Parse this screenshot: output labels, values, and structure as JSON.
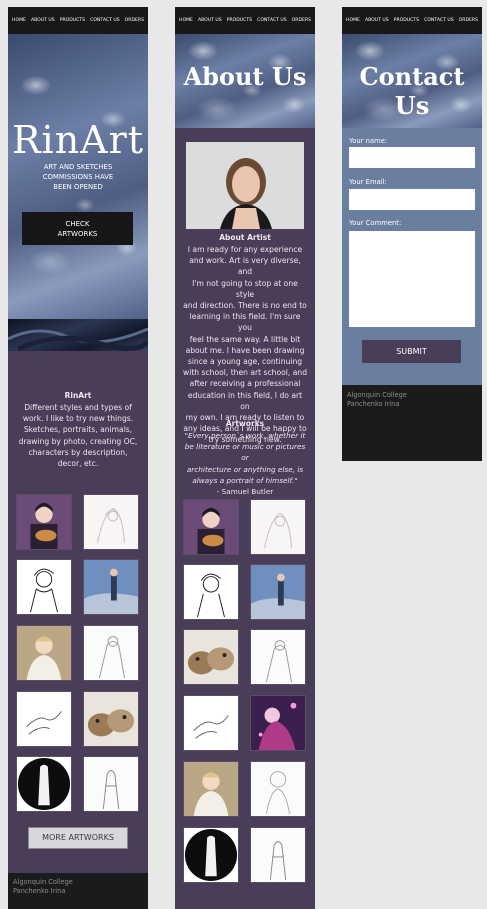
{
  "nav": {
    "items": [
      "HOME",
      "ABOUT US",
      "PRODUCTS",
      "CONTACT US",
      "ORDERS"
    ]
  },
  "home": {
    "hero_title": "RinArt",
    "hero_subtitle_lines": [
      "ART AND SKETCHES",
      "COMMISSIONS HAVE",
      "BEEN OPENED"
    ],
    "check_button_lines": [
      "CHECK",
      "ARTWORKS"
    ],
    "intro_title": "RinArt",
    "intro_lines": [
      "Different styles and types of",
      "work. I like to try new things.",
      "Sketches, portraits, animals,",
      "drawing by photo, creating OC,",
      "characters by description,",
      "decor, etc."
    ],
    "more_button": "MORE ARTWORKS"
  },
  "about": {
    "hero_title": "About Us",
    "artist_title": "About Artist",
    "artist_lines": [
      "I am ready for any experience",
      "and work. Art is very diverse, and",
      "I'm not going to stop at one style",
      "and direction. There is no end to",
      "learning in this field. I'm sure you",
      "feel the same way. A little bit",
      "about me. I have been drawing",
      "since a young age, continuing",
      "with school, then art school, and",
      "after receiving a professional",
      "education in this field, I do art on",
      "my own. I am ready to listen to",
      "any ideas, and I will be happy to",
      "try something new."
    ],
    "artworks_title": "Artworks",
    "quote_lines": [
      "\"Every person`s work, whether it",
      "be literature or music or pictures or",
      "architecture or anything else, is",
      "always a portrait of himself.\""
    ],
    "quote_author": "- Samuel Butler"
  },
  "contact": {
    "hero_title": "Contact Us",
    "name_label": "Your name:",
    "email_label": "Your Email:",
    "comment_label": "Your Comment:",
    "submit_label": "SUBMIT"
  },
  "footer": {
    "line1": "Algonquin College",
    "line2": "Panchenko Irina"
  },
  "colors": {
    "panel_purple": "#4a3d57",
    "contact_blue": "#6a7f9f",
    "nav_black": "#181818"
  }
}
